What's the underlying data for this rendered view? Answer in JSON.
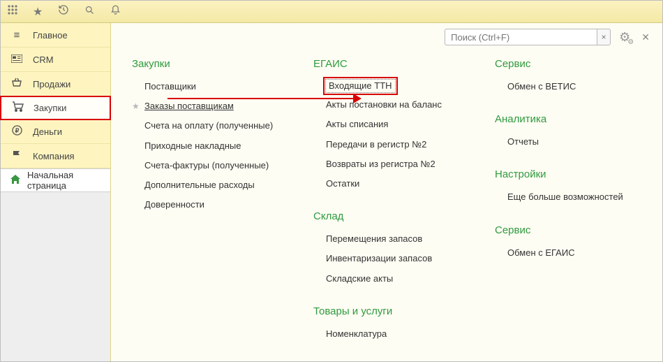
{
  "topbar_icons": [
    "apps",
    "star",
    "history",
    "search",
    "bell"
  ],
  "sidebar": {
    "items": [
      {
        "icon": "≡",
        "label": "Главное"
      },
      {
        "icon": "card",
        "label": "CRM"
      },
      {
        "icon": "basket",
        "label": "Продажи"
      },
      {
        "icon": "cart",
        "label": "Закупки",
        "active": true
      },
      {
        "icon": "ruble",
        "label": "Деньги"
      },
      {
        "icon": "flag",
        "label": "Компания"
      }
    ],
    "start_page": "Начальная страница"
  },
  "search": {
    "placeholder": "Поиск (Ctrl+F)",
    "clear": "×"
  },
  "columns": [
    {
      "sections": [
        {
          "title": "Закупки",
          "items": [
            {
              "label": "Поставщики"
            },
            {
              "label": "Заказы поставщикам",
              "starred": true
            },
            {
              "label": "Счета на оплату (полученные)"
            },
            {
              "label": "Приходные накладные"
            },
            {
              "label": "Счета-фактуры (полученные)"
            },
            {
              "label": "Дополнительные расходы"
            },
            {
              "label": "Доверенности"
            }
          ]
        }
      ]
    },
    {
      "sections": [
        {
          "title": "ЕГАИС",
          "items": [
            {
              "label": "Входящие ТТН",
              "highlight": true
            },
            {
              "label": "Акты постановки на баланс"
            },
            {
              "label": "Акты списания"
            },
            {
              "label": "Передачи в регистр №2"
            },
            {
              "label": "Возвраты из регистра №2"
            },
            {
              "label": "Остатки"
            }
          ]
        },
        {
          "title": "Склад",
          "items": [
            {
              "label": "Перемещения запасов"
            },
            {
              "label": "Инвентаризации запасов"
            },
            {
              "label": "Складские акты"
            }
          ]
        },
        {
          "title": "Товары и услуги",
          "items": [
            {
              "label": "Номенклатура"
            }
          ]
        }
      ]
    },
    {
      "sections": [
        {
          "title": "Сервис",
          "items": [
            {
              "label": "Обмен с ВЕТИС"
            }
          ]
        },
        {
          "title": "Аналитика",
          "items": [
            {
              "label": "Отчеты"
            }
          ]
        },
        {
          "title": "Настройки",
          "items": [
            {
              "label": "Еще больше возможностей"
            }
          ]
        },
        {
          "title": "Сервис",
          "items": [
            {
              "label": "Обмен с ЕГАИС"
            }
          ]
        }
      ]
    }
  ]
}
